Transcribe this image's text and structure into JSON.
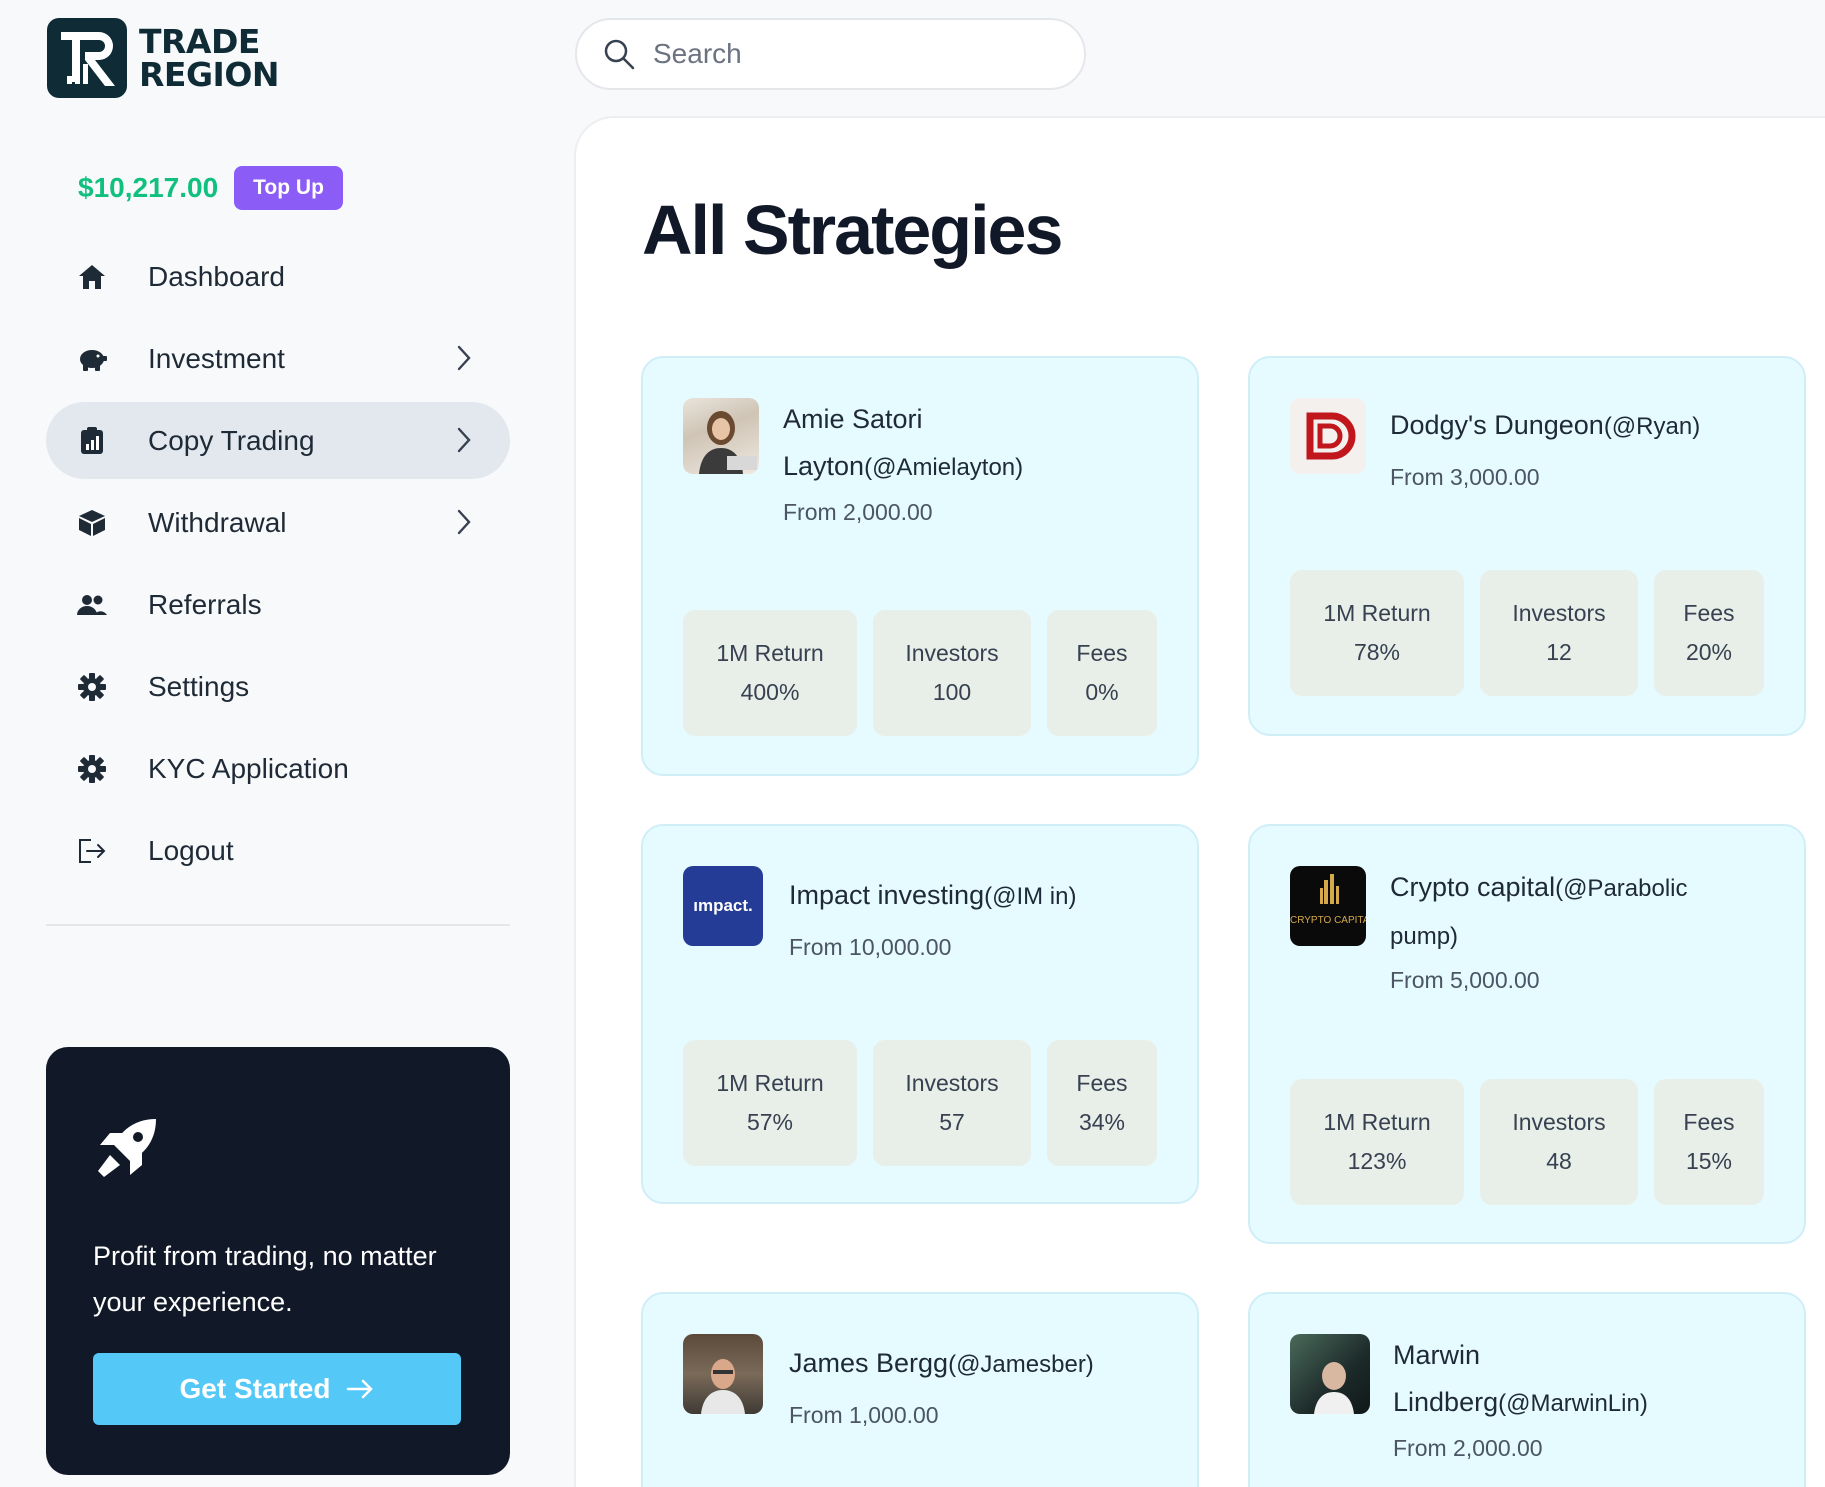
{
  "brand": {
    "line1": "TRADE",
    "line2": "REGION"
  },
  "wallet": {
    "balance": "$10,217.00",
    "topup_label": "Top Up"
  },
  "nav": [
    {
      "label": "Dashboard",
      "icon": "home-icon"
    },
    {
      "label": "Investment",
      "icon": "piggy-bank-icon",
      "has_submenu": true
    },
    {
      "label": "Copy Trading",
      "icon": "clipboard-chart-icon",
      "has_submenu": true,
      "active": true
    },
    {
      "label": "Withdrawal",
      "icon": "box-icon",
      "has_submenu": true
    },
    {
      "label": "Referrals",
      "icon": "users-icon"
    },
    {
      "label": "Settings",
      "icon": "gear-icon"
    },
    {
      "label": "KYC Application",
      "icon": "gear-icon"
    },
    {
      "label": "Logout",
      "icon": "logout-icon"
    }
  ],
  "promo": {
    "text": "Profit from trading, no matter your experience.",
    "button_label": "Get Started",
    "icon": "rocket-icon"
  },
  "search": {
    "placeholder": "Search"
  },
  "page": {
    "title": "All Strategies"
  },
  "stat_labels": {
    "return": "1M Return",
    "investors": "Investors",
    "fees": "Fees"
  },
  "strategies": [
    {
      "name": "Amie Satori Layton",
      "handle": "(@Amielayton)",
      "from": "From 2,000.00",
      "return": "400%",
      "investors": "100",
      "fees": "0%"
    },
    {
      "name": "Dodgy's Dungeon",
      "handle": "(@Ryan)",
      "from": "From 3,000.00",
      "return": "78%",
      "investors": "12",
      "fees": "20%"
    },
    {
      "name": "Impact investing",
      "handle": "(@IM in)",
      "from": "From 10,000.00",
      "return": "57%",
      "investors": "57",
      "fees": "34%",
      "logo_text": "ımpact."
    },
    {
      "name": "Crypto capital",
      "handle": "(@Parabolic pump)",
      "from": "From 5,000.00",
      "return": "123%",
      "investors": "48",
      "fees": "15%",
      "logo_text": "CRYPTO CAPITAL"
    },
    {
      "name": "James Bergg",
      "handle": "(@Jamesber)",
      "from": "From 1,000.00"
    },
    {
      "name": "Marwin Lindberg",
      "handle": "(@MarwinLin)",
      "from": "From 2,000.00"
    }
  ],
  "colors": {
    "accent_green": "#10c07f",
    "accent_purple": "#8b5cf6",
    "cta_blue": "#54c8f7",
    "card_bg": "#e6fbff",
    "stat_bg": "#e8efe8",
    "dark": "#111827"
  }
}
